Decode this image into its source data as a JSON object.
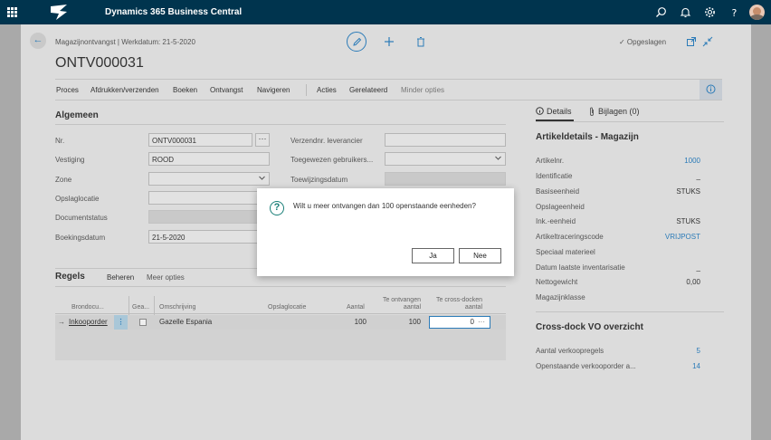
{
  "app": {
    "title": "Dynamics 365 Business Central"
  },
  "header": {
    "breadcrumb": "Magazijnontvangst | Werkdatum: 21-5-2020",
    "doc_title": "ONTV000031",
    "saved": "✓ Opgeslagen"
  },
  "actions": [
    "Proces",
    "Afdrukken/verzenden",
    "Boeken",
    "Ontvangst",
    "Navigeren",
    "Acties",
    "Gerelateerd",
    "Minder opties"
  ],
  "general": {
    "title": "Algemeen",
    "fields": [
      {
        "label": "Nr.",
        "value": "ONTV000031"
      },
      {
        "label": "Vestiging",
        "value": "ROOD"
      },
      {
        "label": "Zone",
        "value": ""
      },
      {
        "label": "Opslaglocatie",
        "value": ""
      },
      {
        "label": "Documentstatus",
        "value": ""
      },
      {
        "label": "Boekingsdatum",
        "value": "21-5-2020"
      }
    ],
    "right_fields": [
      {
        "label": "Verzendnr. leverancier",
        "value": ""
      },
      {
        "label": "Toegewezen gebruikers...",
        "value": ""
      },
      {
        "label": "Toewijzingsdatum",
        "value": ""
      }
    ]
  },
  "lines": {
    "title": "Regels",
    "manage": "Beheren",
    "more": "Meer opties",
    "columns": [
      "Brondocu...",
      "Gea...",
      "Omschrijving",
      "Opslaglocatie",
      "Aantal",
      "Te ontvangen aantal",
      "Te cross-docken aantal"
    ],
    "row": {
      "brondoc": "Inkooporder",
      "omschrijving": "Gazelle Espania",
      "opslaglocatie": "",
      "aantal": "100",
      "te_ontvangen": "100",
      "te_crossdocken": "0"
    }
  },
  "factbox": {
    "tabs": [
      "Details",
      "Bijlagen (0)"
    ],
    "details_title": "Artikeldetails - Magazijn",
    "details": [
      {
        "label": "Artikelnr.",
        "value": "1000",
        "link": true
      },
      {
        "label": "Identificatie",
        "value": "_",
        "link": false
      },
      {
        "label": "Basiseenheid",
        "value": "STUKS",
        "link": false
      },
      {
        "label": "Opslageenheid",
        "value": "",
        "link": false
      },
      {
        "label": "Ink.-eenheid",
        "value": "STUKS",
        "link": false
      },
      {
        "label": "Artikeltraceringscode",
        "value": "VRIJPOST",
        "link": true
      },
      {
        "label": "Speciaal materieel",
        "value": "",
        "link": false
      },
      {
        "label": "Datum laatste inventarisatie",
        "value": "_",
        "link": false
      },
      {
        "label": "Nettogewicht",
        "value": "0,00",
        "link": false
      },
      {
        "label": "Magazijnklasse",
        "value": "",
        "link": false
      }
    ],
    "crossdock_title": "Cross-dock VO overzicht",
    "crossdock": [
      {
        "label": "Aantal verkoopregels",
        "value": "5"
      },
      {
        "label": "Openstaande verkooporder a...",
        "value": "14"
      }
    ]
  },
  "dialog": {
    "message": "Wilt u meer ontvangen dan 100 openstaande eenheden?",
    "yes": "Ja",
    "no": "Nee"
  },
  "colors": {
    "topbar": "#00344e",
    "accent": "#2b7bb8",
    "dialog_icon": "#1a7f78"
  }
}
